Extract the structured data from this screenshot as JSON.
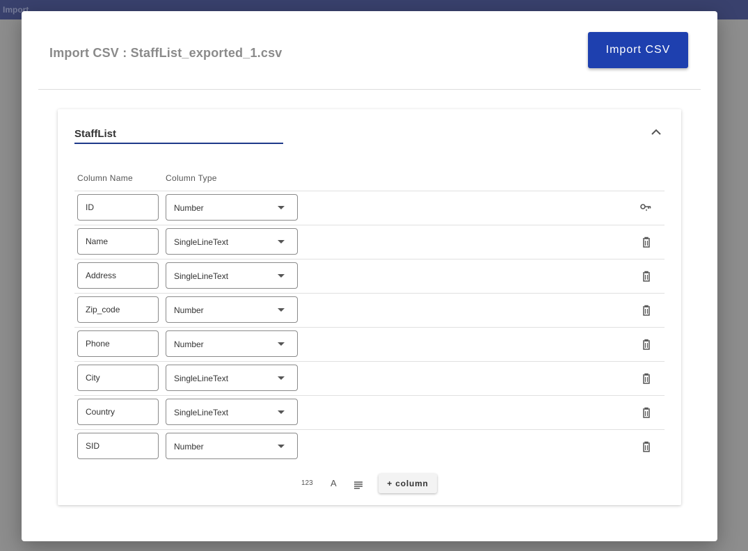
{
  "app": {
    "topbar_title": "Import"
  },
  "dialog": {
    "title": "Import CSV : StaffList_exported_1.csv",
    "import_button_label": "Import CSV"
  },
  "table": {
    "name": "StaffList",
    "header_column_name": "Column Name",
    "header_column_type": "Column Type",
    "rows": [
      {
        "column_name": "ID",
        "column_type": "Number",
        "action_icon": "primary-key-icon"
      },
      {
        "column_name": "Name",
        "column_type": "SingleLineText",
        "action_icon": "delete-icon"
      },
      {
        "column_name": "Address",
        "column_type": "SingleLineText",
        "action_icon": "delete-icon"
      },
      {
        "column_name": "Zip_code",
        "column_type": "Number",
        "action_icon": "delete-icon"
      },
      {
        "column_name": "Phone",
        "column_type": "Number",
        "action_icon": "delete-icon"
      },
      {
        "column_name": "City",
        "column_type": "SingleLineText",
        "action_icon": "delete-icon"
      },
      {
        "column_name": "Country",
        "column_type": "SingleLineText",
        "action_icon": "delete-icon"
      },
      {
        "column_name": "SID",
        "column_type": "Number",
        "action_icon": "delete-icon"
      }
    ]
  },
  "footer": {
    "number_icon_glyph": "123",
    "text_icon_glyph": "A",
    "longtext_icon": "long-text-icon",
    "add_column_label": "+ column"
  },
  "colors": {
    "accent": "#1e40af",
    "topbar": "#1e2a6e",
    "underline": "#1e3a8a"
  }
}
